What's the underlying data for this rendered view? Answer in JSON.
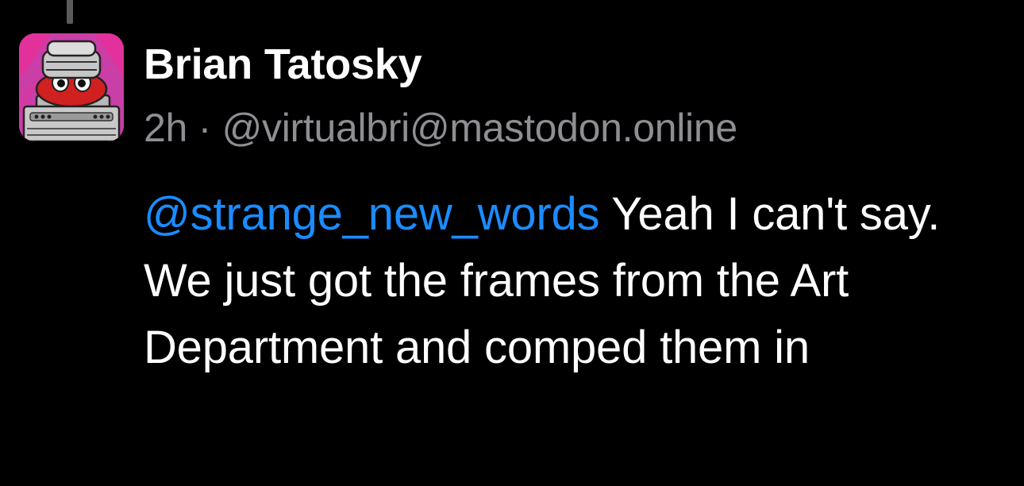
{
  "post": {
    "author": {
      "display_name": "Brian Tatosky",
      "avatar_icon": "robot-avatar-icon"
    },
    "meta": {
      "time": "2h",
      "separator": " · ",
      "handle": "@virtualbri@mastodon.online"
    },
    "content": {
      "mention": "@strange_new_words",
      "text": " Yeah I can't say.  We just got the frames from the Art Department and comped them in"
    }
  },
  "colors": {
    "background": "#000000",
    "mention": "#1a8cff",
    "meta_text": "#8e8e93",
    "primary_text": "#ffffff"
  }
}
